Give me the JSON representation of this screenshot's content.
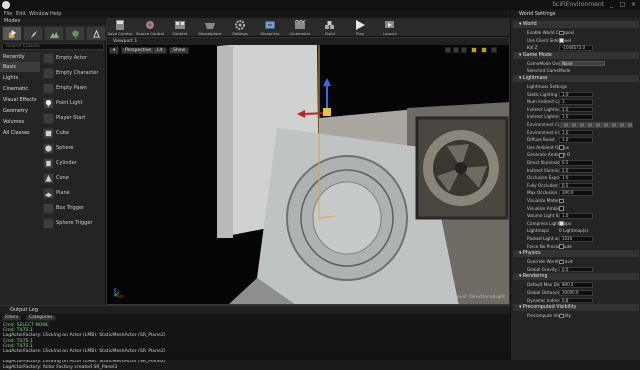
{
  "titlebar": {
    "project": "SciFiEnvironment",
    "window_controls": [
      "_",
      "□",
      "×"
    ]
  },
  "menu": [
    "File",
    "Edit",
    "Window",
    "Help"
  ],
  "modes_panel": {
    "title": "Modes",
    "search_placeholder": "Search Classes",
    "categories": [
      "Recently Placed",
      "Basic",
      "Lights",
      "Cinematic",
      "Visual Effects",
      "Geometry",
      "Volumes",
      "All Classes"
    ],
    "active_category": "Basic",
    "items": [
      "Empty Actor",
      "Empty Character",
      "Empty Pawn",
      "Point Light",
      "Player Start",
      "Cube",
      "Sphere",
      "Cylinder",
      "Cone",
      "Plane",
      "Box Trigger",
      "Sphere Trigger"
    ]
  },
  "toolbar": {
    "buttons": [
      {
        "label": "Save Current",
        "icon": "save-icon"
      },
      {
        "label": "Source Control",
        "icon": "source-control-icon"
      },
      {
        "label": "Content",
        "icon": "content-icon"
      },
      {
        "label": "Marketplace",
        "icon": "marketplace-icon"
      },
      {
        "label": "Settings",
        "icon": "gear-icon"
      },
      {
        "label": "Blueprints",
        "icon": "blueprint-icon"
      },
      {
        "label": "Cinematics",
        "icon": "cinematics-icon"
      },
      {
        "label": "Build",
        "icon": "build-icon"
      },
      {
        "label": "Play",
        "icon": "play-icon"
      },
      {
        "label": "Launch",
        "icon": "launch-icon"
      }
    ]
  },
  "viewport": {
    "tab": "Viewport 1",
    "perspective": "Perspective",
    "lit": "Lit",
    "show": "Show",
    "level_label": "Level: DirectionalLight"
  },
  "details": {
    "title": "World Settings",
    "sections": [
      {
        "name": "World",
        "rows": [
          {
            "label": "Enable World Composi",
            "kind": "checkbox",
            "value": false
          },
          {
            "label": "Use Client Side Level",
            "kind": "checkbox",
            "value": true
          },
          {
            "label": "Kill Z",
            "kind": "number",
            "value": "-1048575.0"
          }
        ]
      },
      {
        "name": "Game Mode",
        "rows": [
          {
            "label": "GameMode Override",
            "kind": "select",
            "value": "None"
          },
          {
            "label": "Selected GameMode",
            "kind": "text",
            "value": ""
          }
        ]
      },
      {
        "name": "Lightmass",
        "rows": [
          {
            "label": "Lightmass Settings",
            "kind": "text",
            "value": ""
          },
          {
            "label": "Static Lighting Leve",
            "kind": "number",
            "value": "1.0"
          },
          {
            "label": "Num Indirect Lighti",
            "kind": "number",
            "value": "3"
          },
          {
            "label": "Indirect Lighting Sm",
            "kind": "number",
            "value": "1.0"
          },
          {
            "label": "Indirect Lighting Qu",
            "kind": "number",
            "value": "1.0"
          },
          {
            "label": "Environment Color",
            "kind": "color",
            "value": ""
          },
          {
            "label": "Environment Intens",
            "kind": "number",
            "value": "1.0"
          },
          {
            "label": "Diffuse Boost",
            "kind": "number",
            "value": "1.0"
          },
          {
            "label": "Use Ambient Occlus",
            "kind": "checkbox",
            "value": false
          },
          {
            "label": "Generate Ambient O",
            "kind": "checkbox",
            "value": false
          },
          {
            "label": "Direct Illumination",
            "kind": "number",
            "value": "0.5"
          },
          {
            "label": "Indirect Illumination",
            "kind": "number",
            "value": "1.0"
          },
          {
            "label": "Occlusion Exponent",
            "kind": "number",
            "value": "1.0"
          },
          {
            "label": "Fully Occluded Sam",
            "kind": "number",
            "value": "0.5"
          },
          {
            "label": "Max Occlusion Dist",
            "kind": "number",
            "value": "200.0"
          },
          {
            "label": "Visualize Material",
            "kind": "checkbox",
            "value": false
          },
          {
            "label": "Visualize Ambient",
            "kind": "checkbox",
            "value": false
          },
          {
            "label": "Volume Light Samp",
            "kind": "number",
            "value": "1.0"
          },
          {
            "label": "Compress Lightmaps",
            "kind": "checkbox",
            "value": true
          },
          {
            "label": "Lightmaps",
            "kind": "text",
            "value": "0 Lightmap(s)"
          },
          {
            "label": "Packed Light and Sha",
            "kind": "number",
            "value": "1024"
          },
          {
            "label": "Force No Precompute",
            "kind": "checkbox",
            "value": false
          }
        ]
      },
      {
        "name": "Physics",
        "rows": [
          {
            "label": "Override World Gravit",
            "kind": "checkbox",
            "value": false
          },
          {
            "label": "Global Gravity Z",
            "kind": "number",
            "value": "0.0"
          }
        ]
      },
      {
        "name": "Rendering",
        "rows": [
          {
            "label": "Default Max Distanc",
            "kind": "number",
            "value": "800.0"
          },
          {
            "label": "Global Distance Fiel",
            "kind": "number",
            "value": "20000.0"
          },
          {
            "label": "Dynamic Indirect Sha",
            "kind": "number",
            "value": "0.8"
          }
        ]
      },
      {
        "name": "Precomputed Visibility",
        "rows": [
          {
            "label": "Precompute Visibility",
            "kind": "checkbox",
            "value": false
          }
        ]
      }
    ]
  },
  "output_log": {
    "title": "Output Log",
    "filters": "Filters",
    "categories": "Categories",
    "lines": [
      {
        "text": "Cmd: SELECT NONE",
        "color": "#7fd47f"
      },
      {
        "text": "Cmd: TILTS 1",
        "color": "#7fd47f"
      },
      {
        "text": "LogActorFactory: Clicking on Actor (LMB): StaticMeshActor (SR_Plane2)",
        "color": "#cfcfcf"
      },
      {
        "text": "Cmd: TILTS 1",
        "color": "#7fd47f"
      },
      {
        "text": "Cmd: TILTS 1",
        "color": "#7fd47f"
      },
      {
        "text": "LogActorFactory: Clicking on Actor (LMB): StaticMeshActor (SR_Plane2)",
        "color": "#cfcfcf"
      },
      {
        "text": "LogActorFactory: Actor Factory created SR_Panel_Lights",
        "color": "#cfcfcf"
      },
      {
        "text": "LogActorFactory: Clicking on Actor (LMB): StaticMeshActor (SR_Plane2)",
        "color": "#cfcfcf"
      },
      {
        "text": "LogActorFactory: Actor Factory created SR_Panel3",
        "color": "#cfcfcf"
      }
    ]
  }
}
